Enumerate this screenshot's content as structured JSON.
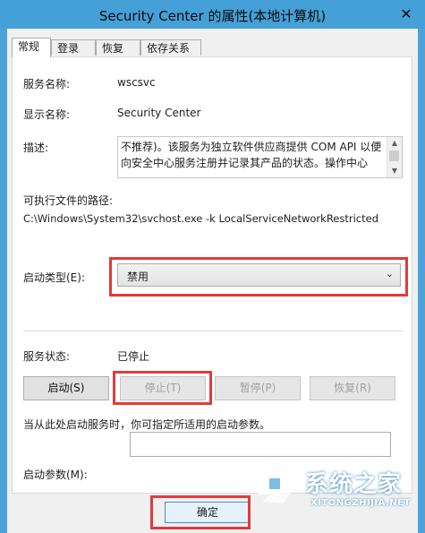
{
  "window": {
    "title": "Security Center 的属性(本地计算机)",
    "close_glyph": "✕"
  },
  "tabs": [
    {
      "label": "常规",
      "active": true
    },
    {
      "label": "登录"
    },
    {
      "label": "恢复"
    },
    {
      "label": "依存关系"
    }
  ],
  "general": {
    "service_name_label": "服务名称:",
    "service_name_value": "wscsvc",
    "display_name_label": "显示名称:",
    "display_name_value": "Security Center",
    "description_label": "描述:",
    "description_text": "不推荐)。该服务为独立软件供应商提供 COM API 以便向安全中心服务注册并记录其产品的状态。操作中心",
    "exe_path_label": "可执行文件的路径:",
    "exe_path_value": "C:\\Windows\\System32\\svchost.exe -k LocalServiceNetworkRestricted",
    "startup_type_label": "启动类型(E):",
    "startup_type_value": "禁用",
    "service_status_label": "服务状态:",
    "service_status_value": "已停止",
    "start_params_hint": "当从此处启动服务时，你可指定所适用的启动参数。",
    "start_params_label": "启动参数(M):",
    "start_params_value": ""
  },
  "buttons": {
    "start": "启动(S)",
    "stop": "停止(T)",
    "pause": "暂停(P)",
    "resume": "恢复(R)",
    "ok": "确定"
  },
  "icons": {
    "close": "close-icon",
    "dropdown": "chevron-down-icon",
    "scroll_up": "scroll-up-icon",
    "scroll_down": "scroll-down-icon"
  },
  "highlight_color": "#e23b3b",
  "watermark": {
    "cn": "系统之家",
    "en": "XITONGZHIJIA.NET"
  }
}
